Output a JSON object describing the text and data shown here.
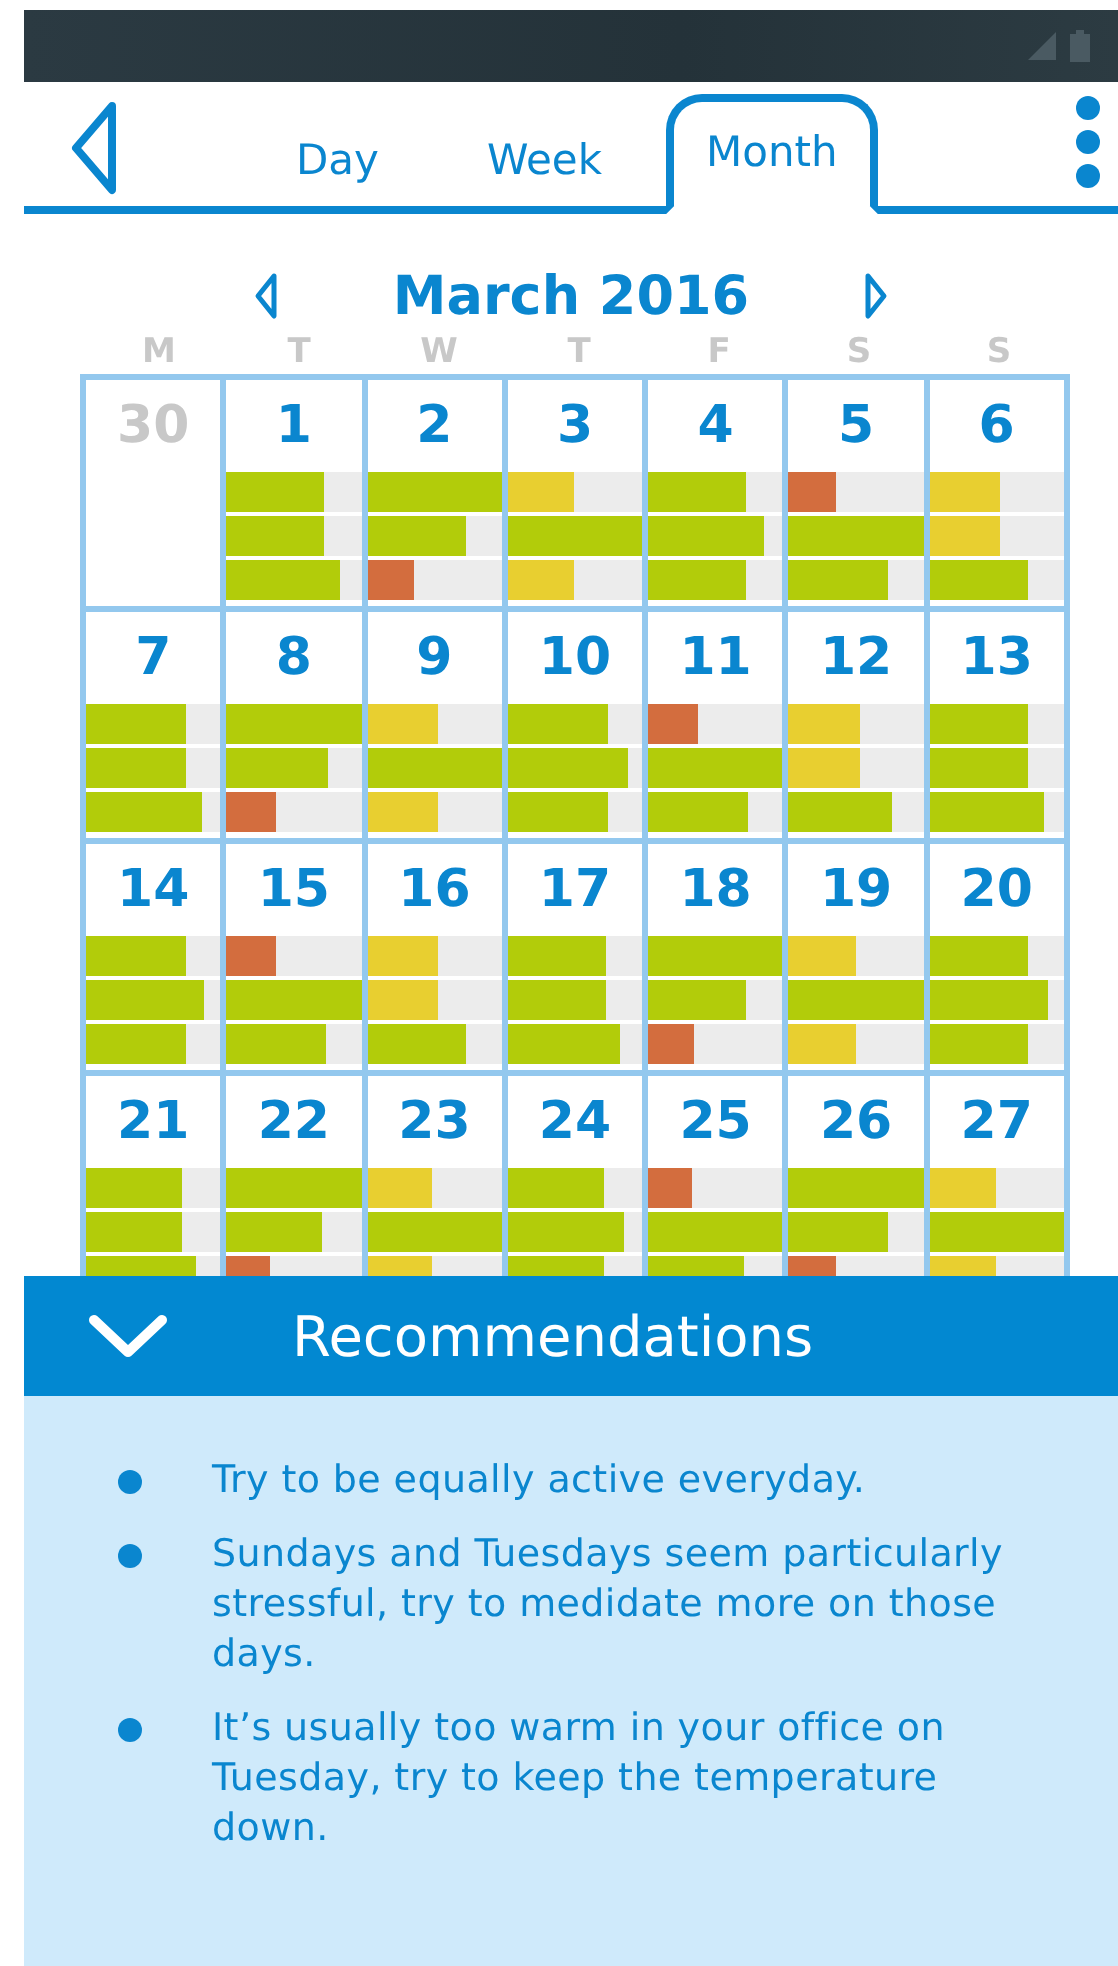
{
  "tabs": [
    {
      "label": "Day",
      "selected": false
    },
    {
      "label": "Week",
      "selected": false
    },
    {
      "label": "Month",
      "selected": true
    }
  ],
  "calendar": {
    "title": "March 2016",
    "weekdays": [
      "M",
      "T",
      "W",
      "T",
      "F",
      "S",
      "S"
    ],
    "days": [
      {
        "date": "30",
        "muted": true
      },
      {
        "date": "1",
        "muted": false,
        "bars": [
          {
            "level": 0.73,
            "color": "#b2cc0a"
          },
          {
            "level": 0.73,
            "color": "#b2cc0a"
          },
          {
            "level": 0.84,
            "color": "#b2cc0a"
          }
        ]
      },
      {
        "date": "2",
        "muted": false,
        "bars": [
          {
            "level": 1.0,
            "color": "#b2cc0a"
          },
          {
            "level": 0.73,
            "color": "#b2cc0a"
          },
          {
            "level": 0.35,
            "color": "#d36d3e"
          }
        ]
      },
      {
        "date": "3",
        "muted": false,
        "bars": [
          {
            "level": 0.5,
            "color": "#e8cf30"
          },
          {
            "level": 1.0,
            "color": "#b2cc0a"
          },
          {
            "level": 0.5,
            "color": "#e8cf30"
          }
        ]
      },
      {
        "date": "4",
        "muted": false,
        "bars": [
          {
            "level": 0.73,
            "color": "#b2cc0a"
          },
          {
            "level": 0.86,
            "color": "#b2cc0a"
          },
          {
            "level": 0.73,
            "color": "#b2cc0a"
          }
        ]
      },
      {
        "date": "5",
        "muted": false,
        "bars": [
          {
            "level": 0.35,
            "color": "#d36d3e"
          },
          {
            "level": 1.0,
            "color": "#b2cc0a"
          },
          {
            "level": 0.73,
            "color": "#b2cc0a"
          }
        ]
      },
      {
        "date": "6",
        "muted": false,
        "bars": [
          {
            "level": 0.52,
            "color": "#e8cf30"
          },
          {
            "level": 0.52,
            "color": "#e8cf30"
          },
          {
            "level": 0.74,
            "color": "#b2cc0a"
          }
        ]
      },
      {
        "date": "7",
        "muted": false,
        "bars": [
          {
            "level": 0.75,
            "color": "#b2cc0a"
          },
          {
            "level": 0.75,
            "color": "#b2cc0a"
          },
          {
            "level": 0.86,
            "color": "#b2cc0a"
          }
        ]
      },
      {
        "date": "8",
        "muted": false,
        "bars": [
          {
            "level": 1.0,
            "color": "#b2cc0a"
          },
          {
            "level": 0.75,
            "color": "#b2cc0a"
          },
          {
            "level": 0.37,
            "color": "#d36d3e"
          }
        ]
      },
      {
        "date": "9",
        "muted": false,
        "bars": [
          {
            "level": 0.52,
            "color": "#e8cf30"
          },
          {
            "level": 1.0,
            "color": "#b2cc0a"
          },
          {
            "level": 0.52,
            "color": "#e8cf30"
          }
        ]
      },
      {
        "date": "10",
        "muted": false,
        "bars": [
          {
            "level": 0.75,
            "color": "#b2cc0a"
          },
          {
            "level": 0.89,
            "color": "#b2cc0a"
          },
          {
            "level": 0.75,
            "color": "#b2cc0a"
          }
        ]
      },
      {
        "date": "11",
        "muted": false,
        "bars": [
          {
            "level": 0.37,
            "color": "#d36d3e"
          },
          {
            "level": 1.0,
            "color": "#b2cc0a"
          },
          {
            "level": 0.74,
            "color": "#b2cc0a"
          }
        ]
      },
      {
        "date": "12",
        "muted": false,
        "bars": [
          {
            "level": 0.53,
            "color": "#e8cf30"
          },
          {
            "level": 0.53,
            "color": "#e8cf30"
          },
          {
            "level": 0.76,
            "color": "#b2cc0a"
          }
        ]
      },
      {
        "date": "13",
        "muted": false,
        "bars": [
          {
            "level": 0.74,
            "color": "#b2cc0a"
          },
          {
            "level": 0.74,
            "color": "#b2cc0a"
          },
          {
            "level": 0.85,
            "color": "#b2cc0a"
          }
        ]
      },
      {
        "date": "14",
        "muted": false,
        "bars": [
          {
            "level": 0.74,
            "color": "#b2cc0a"
          },
          {
            "level": 0.88,
            "color": "#b2cc0a"
          },
          {
            "level": 0.74,
            "color": "#b2cc0a"
          }
        ]
      },
      {
        "date": "15",
        "muted": false,
        "bars": [
          {
            "level": 0.36,
            "color": "#d36d3e"
          },
          {
            "level": 1.0,
            "color": "#b2cc0a"
          },
          {
            "level": 0.74,
            "color": "#b2cc0a"
          }
        ]
      },
      {
        "date": "16",
        "muted": false,
        "bars": [
          {
            "level": 0.52,
            "color": "#e8cf30"
          },
          {
            "level": 0.52,
            "color": "#e8cf30"
          },
          {
            "level": 0.74,
            "color": "#b2cc0a"
          }
        ]
      },
      {
        "date": "17",
        "muted": false,
        "bars": [
          {
            "level": 0.73,
            "color": "#b2cc0a"
          },
          {
            "level": 0.73,
            "color": "#b2cc0a"
          },
          {
            "level": 0.84,
            "color": "#b2cc0a"
          }
        ]
      },
      {
        "date": "18",
        "muted": false,
        "bars": [
          {
            "level": 1.0,
            "color": "#b2cc0a"
          },
          {
            "level": 0.72,
            "color": "#b2cc0a"
          },
          {
            "level": 0.34,
            "color": "#d36d3e"
          }
        ]
      },
      {
        "date": "19",
        "muted": false,
        "bars": [
          {
            "level": 0.5,
            "color": "#e8cf30"
          },
          {
            "level": 1.0,
            "color": "#b2cc0a"
          },
          {
            "level": 0.5,
            "color": "#e8cf30"
          }
        ]
      },
      {
        "date": "20",
        "muted": false,
        "bars": [
          {
            "level": 0.73,
            "color": "#b2cc0a"
          },
          {
            "level": 0.88,
            "color": "#b2cc0a"
          },
          {
            "level": 0.73,
            "color": "#b2cc0a"
          }
        ]
      },
      {
        "date": "21",
        "muted": false,
        "bars": [
          {
            "level": 0.71,
            "color": "#b2cc0a"
          },
          {
            "level": 0.71,
            "color": "#b2cc0a"
          },
          {
            "level": 0.82,
            "color": "#b2cc0a"
          }
        ]
      },
      {
        "date": "22",
        "muted": false,
        "bars": [
          {
            "level": 1.0,
            "color": "#b2cc0a"
          },
          {
            "level": 0.71,
            "color": "#b2cc0a"
          },
          {
            "level": 0.33,
            "color": "#d36d3e"
          }
        ]
      },
      {
        "date": "23",
        "muted": false,
        "bars": [
          {
            "level": 0.48,
            "color": "#e8cf30"
          },
          {
            "level": 1.0,
            "color": "#b2cc0a"
          },
          {
            "level": 0.48,
            "color": "#e8cf30"
          }
        ]
      },
      {
        "date": "24",
        "muted": false,
        "bars": [
          {
            "level": 0.72,
            "color": "#b2cc0a"
          },
          {
            "level": 0.87,
            "color": "#b2cc0a"
          },
          {
            "level": 0.72,
            "color": "#b2cc0a"
          }
        ]
      },
      {
        "date": "25",
        "muted": false,
        "bars": [
          {
            "level": 0.33,
            "color": "#d36d3e"
          },
          {
            "level": 1.0,
            "color": "#b2cc0a"
          },
          {
            "level": 0.71,
            "color": "#b2cc0a"
          }
        ]
      },
      {
        "date": "26",
        "muted": false,
        "bars": [
          {
            "level": 1.0,
            "color": "#b2cc0a"
          },
          {
            "level": 0.73,
            "color": "#b2cc0a"
          },
          {
            "level": 0.35,
            "color": "#d36d3e"
          }
        ]
      },
      {
        "date": "27",
        "muted": false,
        "bars": [
          {
            "level": 0.5,
            "color": "#e8cf30"
          },
          {
            "level": 1.0,
            "color": "#b2cc0a"
          },
          {
            "level": 0.5,
            "color": "#e8cf30"
          }
        ]
      }
    ]
  },
  "recommendations": {
    "title": "Recommendations",
    "expanded": true,
    "items": [
      "Try to be equally active everyday.",
      "Sundays and Tuesdays seem particularly stressful, try to medidate more on those days.",
      "It’s usually too warm in your office on Tuesday, try to keep the temperature down."
    ]
  }
}
